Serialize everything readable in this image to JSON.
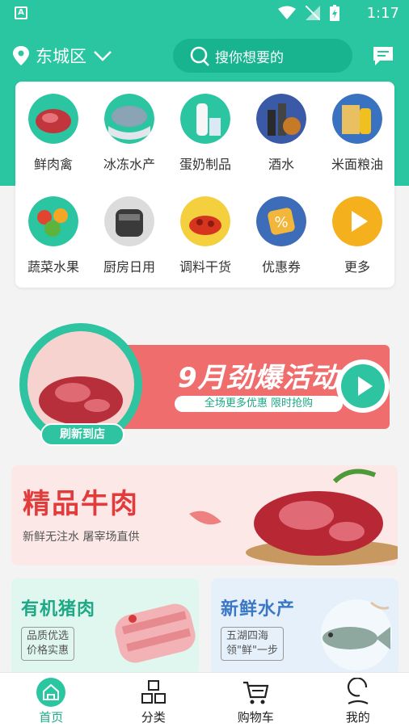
{
  "status_bar": {
    "time": "1:17",
    "badge": "A"
  },
  "header": {
    "city": "东城区",
    "search_placeholder": "搜你想要的"
  },
  "categories": [
    {
      "label": "鲜肉禽",
      "icon": "meat-icon"
    },
    {
      "label": "冰冻水产",
      "icon": "fish-icon"
    },
    {
      "label": "蛋奶制品",
      "icon": "milk-icon"
    },
    {
      "label": "酒水",
      "icon": "liquor-icon"
    },
    {
      "label": "米面粮油",
      "icon": "oil-icon"
    },
    {
      "label": "蔬菜水果",
      "icon": "vegetable-icon"
    },
    {
      "label": "厨房日用",
      "icon": "cooker-icon"
    },
    {
      "label": "调料干货",
      "icon": "spice-icon"
    },
    {
      "label": "优惠券",
      "icon": "coupon-icon"
    },
    {
      "label": "更多",
      "icon": "more-icon"
    }
  ],
  "promo": {
    "title": "9月劲爆活动",
    "subtitle": "全场更多优惠   限时抢购",
    "badge": "刷新到店"
  },
  "beef_banner": {
    "title": "精品牛肉",
    "subtitle": "新鲜无注水 屠宰场直供"
  },
  "pork_card": {
    "title": "有机猪肉",
    "tag_line1": "品质优选",
    "tag_line2": "价格实惠"
  },
  "seafood_card": {
    "title": "新鲜水产",
    "tag_line1": "五湖四海",
    "tag_line2": "领\"鲜\"一步"
  },
  "tabs": [
    {
      "label": "首页",
      "active": true
    },
    {
      "label": "分类",
      "active": false
    },
    {
      "label": "购物车",
      "active": false
    },
    {
      "label": "我的",
      "active": false
    }
  ],
  "colors": {
    "brand": "#29c6a1",
    "promo_red": "#f06d6d",
    "beef_red": "#e23b3b"
  }
}
